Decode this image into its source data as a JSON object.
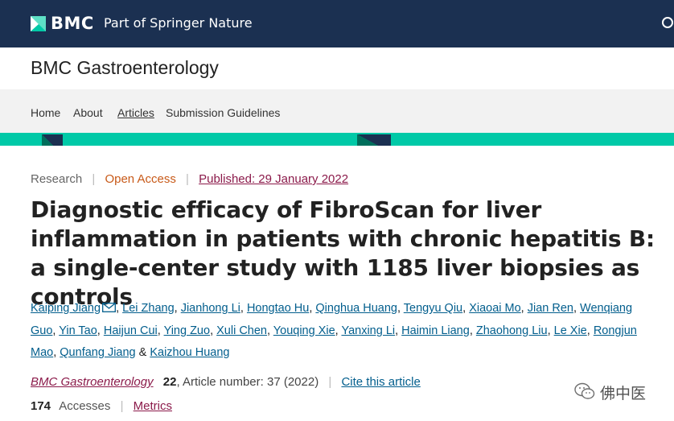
{
  "header": {
    "brand": "BMC",
    "tagline": "Part of Springer Nature"
  },
  "journal": {
    "title": "BMC Gastroenterology"
  },
  "nav": {
    "items": [
      "Home",
      "About",
      "Articles",
      "Submission Guidelines"
    ],
    "active": "Articles"
  },
  "article": {
    "type": "Research",
    "access": "Open Access",
    "published": "Published: 29 January 2022",
    "title": "Diagnostic efficacy of FibroScan for liver inflammation in patients with chronic hepatitis B: a single-center study with 1185 liver biopsies as controls",
    "authors": [
      "Kaiping Jiang",
      "Lei Zhang",
      "Jianhong Li",
      "Hongtao Hu",
      "Qinghua Huang",
      "Tengyu Qiu",
      "Xiaoai Mo",
      "Jian Ren",
      "Wenqiang Guo",
      "Yin Tao",
      "Haijun Cui",
      "Ying Zuo",
      "Xuli Chen",
      "Youqing Xie",
      "Yanxing Li",
      "Haimin Liang",
      "Zhaohong Liu",
      "Le Xie",
      "Rongjun Mao",
      "Qunfang Jiang",
      "Kaizhou Huang"
    ],
    "author_sep": ", ",
    "last_sep": " & ",
    "journal_ref": "BMC Gastroenterology",
    "volume": "22",
    "article_info": ", Article number: 37 (2022)",
    "cite_label": "Cite this article",
    "accesses_count": "174",
    "accesses_label": "Accesses",
    "metrics_label": "Metrics"
  },
  "watermark": {
    "text": "佛中医",
    "icon": "wechat-icon"
  },
  "colors": {
    "topbar": "#1b3051",
    "accent_stripe": "#00c9a7",
    "link": "#025e8d",
    "open_access": "#c85a19",
    "published_link": "#8b1a4a"
  }
}
